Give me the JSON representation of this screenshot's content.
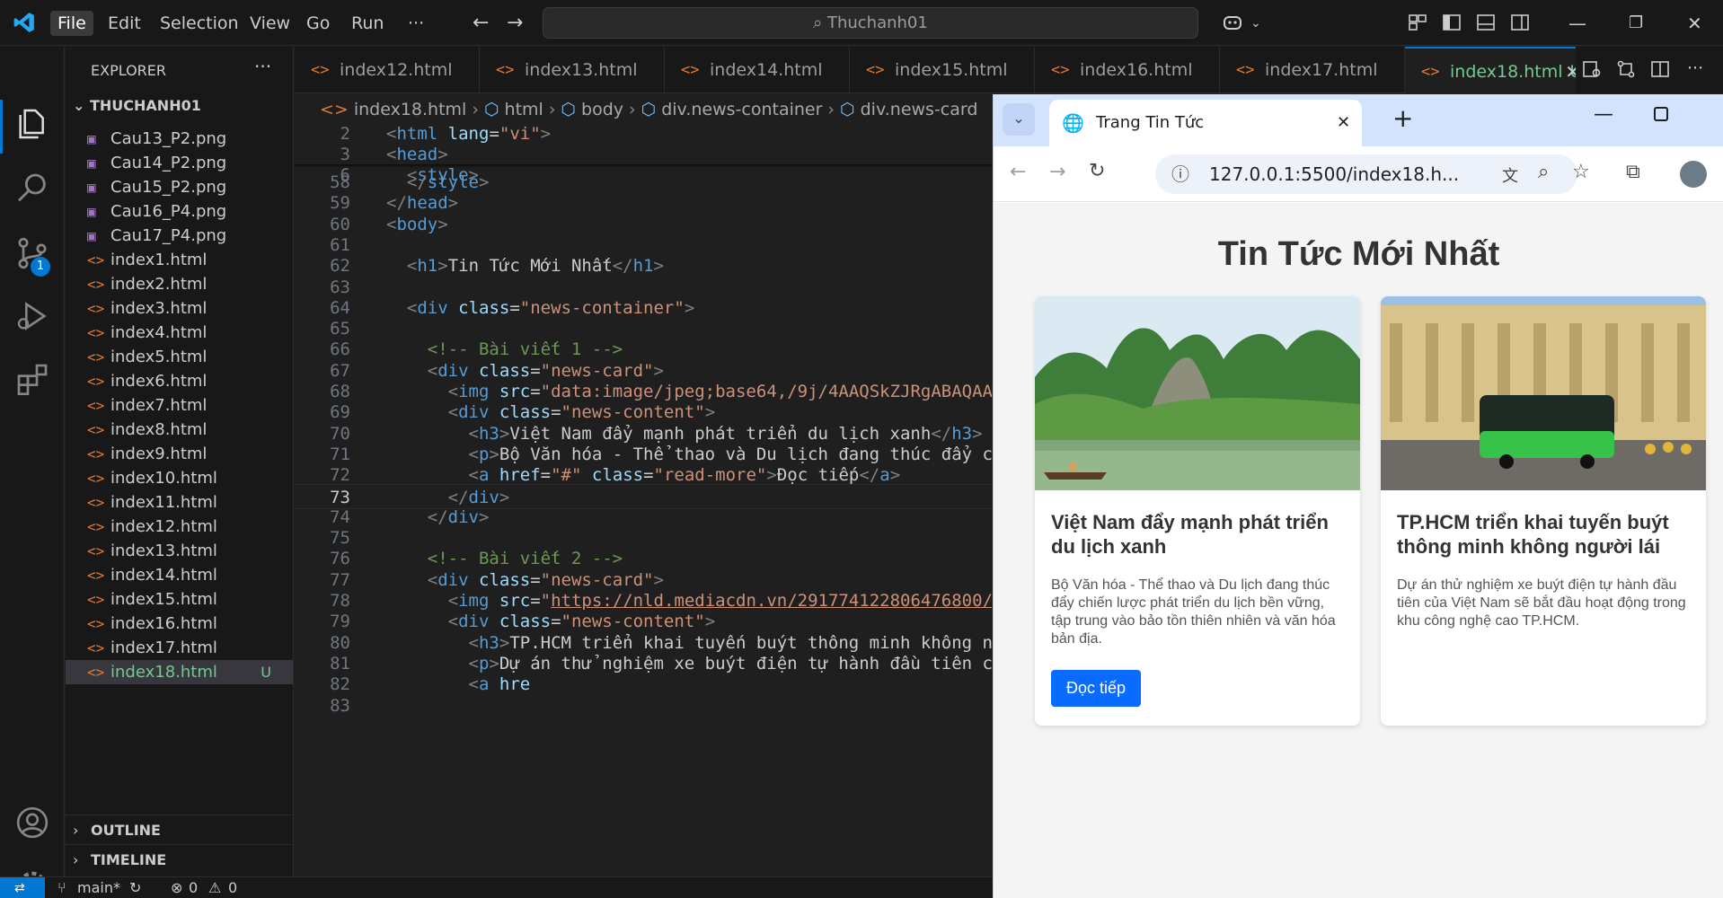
{
  "menu": {
    "file": "File",
    "edit": "Edit",
    "selection": "Selection",
    "view": "View",
    "go": "Go",
    "run": "Run",
    "more": "···"
  },
  "search": {
    "text": "Thuchanh01"
  },
  "explorer": {
    "title": "EXPLORER",
    "more": "···",
    "folder": "THUCHANH01",
    "files": [
      {
        "name": "Cau13_P2.png",
        "type": "img"
      },
      {
        "name": "Cau14_P2.png",
        "type": "img"
      },
      {
        "name": "Cau15_P2.png",
        "type": "img"
      },
      {
        "name": "Cau16_P4.png",
        "type": "img"
      },
      {
        "name": "Cau17_P4.png",
        "type": "img"
      },
      {
        "name": "index1.html",
        "type": "html"
      },
      {
        "name": "index2.html",
        "type": "html"
      },
      {
        "name": "index3.html",
        "type": "html"
      },
      {
        "name": "index4.html",
        "type": "html"
      },
      {
        "name": "index5.html",
        "type": "html"
      },
      {
        "name": "index6.html",
        "type": "html"
      },
      {
        "name": "index7.html",
        "type": "html"
      },
      {
        "name": "index8.html",
        "type": "html"
      },
      {
        "name": "index9.html",
        "type": "html"
      },
      {
        "name": "index10.html",
        "type": "html"
      },
      {
        "name": "index11.html",
        "type": "html"
      },
      {
        "name": "index12.html",
        "type": "html"
      },
      {
        "name": "index13.html",
        "type": "html"
      },
      {
        "name": "index14.html",
        "type": "html"
      },
      {
        "name": "index15.html",
        "type": "html"
      },
      {
        "name": "index16.html",
        "type": "html"
      },
      {
        "name": "index17.html",
        "type": "html"
      },
      {
        "name": "index18.html",
        "type": "html",
        "status": "U"
      }
    ],
    "outline": "OUTLINE",
    "timeline": "TIMELINE"
  },
  "activity": {
    "scm_badge": "1"
  },
  "tabs": [
    {
      "label": "index12.html"
    },
    {
      "label": "index13.html"
    },
    {
      "label": "index14.html"
    },
    {
      "label": "index15.html"
    },
    {
      "label": "index16.html"
    },
    {
      "label": "index17.html"
    },
    {
      "label": "index18.html",
      "status": "U",
      "active": true
    }
  ],
  "breadcrumb": [
    "index18.html",
    "html",
    "body",
    "div.news-container",
    "div.news-card"
  ],
  "editor": {
    "sticky_lines": [
      {
        "n": "2",
        "tokens": [
          [
            "b",
            "<"
          ],
          [
            "t",
            "html"
          ],
          [
            "x",
            " "
          ],
          [
            "a",
            "lang"
          ],
          [
            "x",
            "="
          ],
          [
            "s",
            "\"vi\""
          ],
          [
            "b",
            ">"
          ]
        ]
      },
      {
        "n": "3",
        "tokens": [
          [
            "b",
            "<"
          ],
          [
            "t",
            "head"
          ],
          [
            "b",
            ">"
          ]
        ]
      },
      {
        "n": "6",
        "tokens": [
          [
            "x",
            "  "
          ],
          [
            "b",
            "<"
          ],
          [
            "t",
            "style"
          ],
          [
            "b",
            ">"
          ]
        ]
      }
    ],
    "lines": [
      {
        "n": "58",
        "tokens": [
          [
            "x",
            "  "
          ],
          [
            "b",
            "</"
          ],
          [
            "t",
            "style"
          ],
          [
            "b",
            ">"
          ]
        ]
      },
      {
        "n": "59",
        "tokens": [
          [
            "b",
            "</"
          ],
          [
            "t",
            "head"
          ],
          [
            "b",
            ">"
          ]
        ]
      },
      {
        "n": "60",
        "tokens": [
          [
            "b",
            "<"
          ],
          [
            "t",
            "body"
          ],
          [
            "b",
            ">"
          ]
        ]
      },
      {
        "n": "61",
        "tokens": []
      },
      {
        "n": "62",
        "tokens": [
          [
            "x",
            "  "
          ],
          [
            "b",
            "<"
          ],
          [
            "t",
            "h1"
          ],
          [
            "b",
            ">"
          ],
          [
            "x",
            "Tin Tức Mới Nhất"
          ],
          [
            "b",
            "</"
          ],
          [
            "t",
            "h1"
          ],
          [
            "b",
            ">"
          ]
        ]
      },
      {
        "n": "63",
        "tokens": []
      },
      {
        "n": "64",
        "tokens": [
          [
            "x",
            "  "
          ],
          [
            "b",
            "<"
          ],
          [
            "t",
            "div"
          ],
          [
            "x",
            " "
          ],
          [
            "a",
            "class"
          ],
          [
            "x",
            "="
          ],
          [
            "s",
            "\"news-container\""
          ],
          [
            "b",
            ">"
          ]
        ]
      },
      {
        "n": "65",
        "tokens": []
      },
      {
        "n": "66",
        "tokens": [
          [
            "x",
            "    "
          ],
          [
            "c",
            "<!-- Bài viết 1 -->"
          ]
        ]
      },
      {
        "n": "67",
        "tokens": [
          [
            "x",
            "    "
          ],
          [
            "b",
            "<"
          ],
          [
            "t",
            "div"
          ],
          [
            "x",
            " "
          ],
          [
            "a",
            "class"
          ],
          [
            "x",
            "="
          ],
          [
            "s",
            "\"news-card\""
          ],
          [
            "b",
            ">"
          ]
        ]
      },
      {
        "n": "68",
        "tokens": [
          [
            "x",
            "      "
          ],
          [
            "b",
            "<"
          ],
          [
            "t",
            "img"
          ],
          [
            "x",
            " "
          ],
          [
            "a",
            "src"
          ],
          [
            "x",
            "="
          ],
          [
            "s",
            "\"data:image/jpeg;base64,/9j/4AAQSkZJRgABAQAA"
          ]
        ]
      },
      {
        "n": "69",
        "tokens": [
          [
            "x",
            "      "
          ],
          [
            "b",
            "<"
          ],
          [
            "t",
            "div"
          ],
          [
            "x",
            " "
          ],
          [
            "a",
            "class"
          ],
          [
            "x",
            "="
          ],
          [
            "s",
            "\"news-content\""
          ],
          [
            "b",
            ">"
          ]
        ]
      },
      {
        "n": "70",
        "tokens": [
          [
            "x",
            "        "
          ],
          [
            "b",
            "<"
          ],
          [
            "t",
            "h3"
          ],
          [
            "b",
            ">"
          ],
          [
            "x",
            "Việt Nam đẩy mạnh phát triển du lịch xanh"
          ],
          [
            "b",
            "</"
          ],
          [
            "t",
            "h3"
          ],
          [
            "b",
            ">"
          ]
        ]
      },
      {
        "n": "71",
        "tokens": [
          [
            "x",
            "        "
          ],
          [
            "b",
            "<"
          ],
          [
            "t",
            "p"
          ],
          [
            "b",
            ">"
          ],
          [
            "x",
            "Bộ Văn hóa - Thể thao và Du lịch đang thúc đẩy c"
          ]
        ]
      },
      {
        "n": "72",
        "tokens": [
          [
            "x",
            "        "
          ],
          [
            "b",
            "<"
          ],
          [
            "t",
            "a"
          ],
          [
            "x",
            " "
          ],
          [
            "a",
            "href"
          ],
          [
            "x",
            "="
          ],
          [
            "s",
            "\"#\""
          ],
          [
            "x",
            " "
          ],
          [
            "a",
            "class"
          ],
          [
            "x",
            "="
          ],
          [
            "s",
            "\"read-more\""
          ],
          [
            "b",
            ">"
          ],
          [
            "x",
            "Đọc tiếp"
          ],
          [
            "b",
            "</"
          ],
          [
            "t",
            "a"
          ],
          [
            "b",
            ">"
          ]
        ]
      },
      {
        "n": "73",
        "tokens": [
          [
            "x",
            "      "
          ],
          [
            "b",
            "</"
          ],
          [
            "t",
            "div"
          ],
          [
            "b",
            ">"
          ]
        ],
        "current": true
      },
      {
        "n": "74",
        "tokens": [
          [
            "x",
            "    "
          ],
          [
            "b",
            "</"
          ],
          [
            "t",
            "div"
          ],
          [
            "b",
            ">"
          ]
        ]
      },
      {
        "n": "75",
        "tokens": []
      },
      {
        "n": "76",
        "tokens": [
          [
            "x",
            "    "
          ],
          [
            "c",
            "<!-- Bài viết 2 -->"
          ]
        ]
      },
      {
        "n": "77",
        "tokens": [
          [
            "x",
            "    "
          ],
          [
            "b",
            "<"
          ],
          [
            "t",
            "div"
          ],
          [
            "x",
            " "
          ],
          [
            "a",
            "class"
          ],
          [
            "x",
            "="
          ],
          [
            "s",
            "\"news-card\""
          ],
          [
            "b",
            ">"
          ]
        ]
      },
      {
        "n": "78",
        "tokens": [
          [
            "x",
            "      "
          ],
          [
            "b",
            "<"
          ],
          [
            "t",
            "img"
          ],
          [
            "x",
            " "
          ],
          [
            "a",
            "src"
          ],
          [
            "x",
            "="
          ],
          [
            "s",
            "\""
          ],
          [
            "link",
            "https://nld.mediacdn.vn/291774122806476800/"
          ]
        ]
      },
      {
        "n": "79",
        "tokens": [
          [
            "x",
            "      "
          ],
          [
            "b",
            "<"
          ],
          [
            "t",
            "div"
          ],
          [
            "x",
            " "
          ],
          [
            "a",
            "class"
          ],
          [
            "x",
            "="
          ],
          [
            "s",
            "\"news-content\""
          ],
          [
            "b",
            ">"
          ]
        ]
      },
      {
        "n": "80",
        "tokens": [
          [
            "x",
            "        "
          ],
          [
            "b",
            "<"
          ],
          [
            "t",
            "h3"
          ],
          [
            "b",
            ">"
          ],
          [
            "x",
            "TP.HCM triển khai tuyến buýt thông minh không n"
          ]
        ]
      },
      {
        "n": "81",
        "tokens": [
          [
            "x",
            "        "
          ],
          [
            "b",
            "<"
          ],
          [
            "t",
            "p"
          ],
          [
            "b",
            ">"
          ],
          [
            "x",
            "Dự án thử nghiệm xe buýt điện tự hành đầu tiên c"
          ]
        ]
      },
      {
        "n": "82",
        "tokens": [
          [
            "x",
            "        "
          ],
          [
            "b",
            "<"
          ],
          [
            "t",
            "a"
          ],
          [
            "x",
            " "
          ],
          [
            "a",
            "hre"
          ]
        ]
      },
      {
        "n": "83",
        "tokens": []
      }
    ]
  },
  "browser": {
    "tab_title": "Trang Tin Tức",
    "url": "127.0.0.1:5500/index18.h...",
    "page_heading": "Tin Tức Mới Nhất",
    "cards": [
      {
        "title": "Việt Nam đẩy mạnh phát triển du lịch xanh",
        "body": "Bộ Văn hóa - Thể thao và Du lịch đang thúc đẩy chiến lược phát triển du lịch bền vững, tập trung vào bảo tồn thiên nhiên và văn hóa bản địa.",
        "button": "Đọc tiếp"
      },
      {
        "title": "TP.HCM triển khai tuyến buýt thông minh không người lái",
        "body": "Dự án thử nghiệm xe buýt điện tự hành đầu tiên của Việt Nam sẽ bắt đầu hoạt động trong khu công nghệ cao TP.HCM."
      }
    ]
  },
  "status": {
    "branch": "main*",
    "errors": "0",
    "warnings": "0"
  },
  "colors": {
    "accent": "#0078d4",
    "untracked": "#73c991",
    "button": "#0a6cff"
  }
}
